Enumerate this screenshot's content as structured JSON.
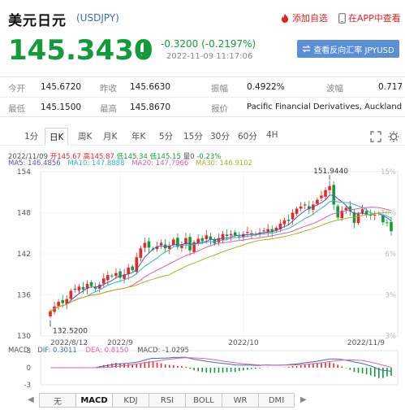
{
  "header": {
    "title": "美元日元",
    "code": "(USDJPY)",
    "add_label": "添加自选",
    "app_label": "在APP中查看"
  },
  "quote": {
    "price": "145.3430",
    "change": "-0.3200 (-0.2197%)",
    "time": "2022-11-09 11:17:06",
    "reverse_label": "查看反向汇率 JPYUSD"
  },
  "stats": {
    "row1": [
      {
        "label": "今开",
        "value": "145.6720"
      },
      {
        "label": "昨收",
        "value": "145.6630"
      },
      {
        "label": "振幅",
        "value": "0.4922%"
      },
      {
        "label": "波幅",
        "value": "0.717"
      }
    ],
    "row2": [
      {
        "label": "最低",
        "value": "145.1500"
      },
      {
        "label": "最高",
        "value": "145.8670"
      },
      {
        "label": "报价",
        "value": "Pacific Financial Derivatives, Auckland"
      }
    ]
  },
  "periods": [
    "1分",
    "日K",
    "周K",
    "月K",
    "年K",
    "5分",
    "15分",
    "30分",
    "60分",
    "4H"
  ],
  "active_period": "日K",
  "legend": {
    "date": "2022/11/09",
    "open_label": "开",
    "open": "145.67",
    "high_label": "高",
    "high": "145.87",
    "low_label": "低",
    "low": "145.34",
    "close_label": "低",
    "close": "145.15",
    "vol_label": "量",
    "vol": "0",
    "pct": "-0.23%",
    "ma5": "MA5: 146.4856",
    "ma10": "MA10: 147.8888",
    "ma20": "MA20: 147.7966",
    "ma30": "MA30: 146.9102"
  },
  "chart_data": {
    "type": "candlestick",
    "y_ticks": [
      "154",
      "148",
      "142",
      "136",
      "130"
    ],
    "right_ticks": [
      "15%",
      "10%",
      "6%",
      "3%",
      "3%"
    ],
    "x_labels": [
      "2022/8/12",
      "2022/9",
      "2022/10",
      "2022/11/9"
    ],
    "high_marker": "151.9440",
    "low_marker": "132.5200",
    "ylim": [
      130,
      154
    ],
    "closes": [
      133.6,
      134.3,
      135.0,
      134.8,
      135.4,
      136.6,
      136.9,
      137.2,
      136.8,
      137.6,
      137.3,
      136.9,
      137.5,
      138.4,
      138.9,
      138.7,
      139.2,
      138.5,
      139.0,
      140.0,
      139.6,
      141.5,
      142.8,
      143.6,
      142.9,
      142.7,
      143.1,
      143.6,
      142.8,
      143.2,
      144.1,
      143.0,
      143.4,
      144.3,
      142.5,
      143.7,
      144.2,
      143.9,
      144.7,
      144.1,
      143.5,
      144.3,
      144.9,
      144.6,
      144.9,
      144.7,
      144.4,
      144.9,
      145.2,
      145.0,
      144.8,
      145.1,
      145.4,
      145.6,
      145.2,
      145.8,
      146.4,
      146.9,
      146.8,
      148.0,
      148.6,
      148.9,
      149.2,
      148.5,
      149.2,
      149.9,
      150.5,
      151.3,
      151.9,
      149.2,
      147.3,
      148.3,
      148.7,
      148.2,
      146.5,
      147.8,
      148.5,
      147.8,
      147.6,
      147.7,
      147.9,
      146.6,
      146.5,
      145.3
    ],
    "macd": {
      "dif": "DIF: 0.3011",
      "dea": "DEA: 0.8150",
      "macd": "MACD: -1.0295",
      "y_ticks": [
        "3",
        "0",
        "-3"
      ]
    }
  },
  "indicator_tabs": [
    "无",
    "MACD",
    "KDJ",
    "RSI",
    "BOLL",
    "WR",
    "DMI"
  ],
  "active_indicator": "MACD",
  "colors": {
    "up": "#e22a2a",
    "down": "#139a39",
    "ma5": "#5555aa",
    "ma10": "#2fb6c6",
    "ma20": "#e05fa8",
    "ma30": "#a8b41e"
  }
}
